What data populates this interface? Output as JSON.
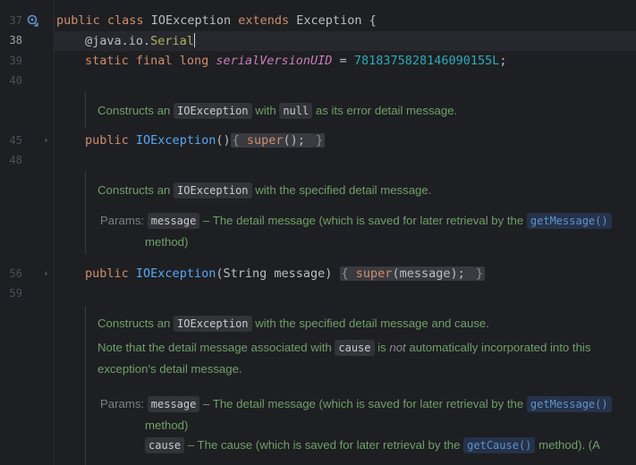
{
  "gutter": {
    "line_numbers": [
      "37",
      "38",
      "39",
      "40",
      "45",
      "48",
      "56",
      "59"
    ]
  },
  "code": {
    "class_decl": {
      "kw1": "public",
      "kw2": "class",
      "name": "IOException",
      "kw3": "extends",
      "parent": "Exception",
      "brace": "{"
    },
    "annotation": {
      "at": "@java.io.",
      "name": "Serial"
    },
    "field": {
      "kw1": "static",
      "kw2": "final",
      "kw3": "long",
      "name": "serialVersionUID",
      "eq": "=",
      "value": "7818375828146090155L",
      "semi": ";"
    },
    "ctor1": {
      "kw": "public",
      "name": "IOException",
      "parens": "()",
      "open": "{",
      "body_kw": "super",
      "body_rest": "();",
      "close": "}"
    },
    "ctor2": {
      "kw": "public",
      "name": "IOException",
      "params": "(String message)",
      "open": "{",
      "body_kw": "super",
      "body_rest": "(message);",
      "close": "}"
    }
  },
  "docs": {
    "doc1": {
      "pre": "Constructs an",
      "chip": "IOException",
      "mid": "with",
      "chip2": "null",
      "post": "as its error detail message."
    },
    "doc2": {
      "pre": "Constructs an",
      "chip": "IOException",
      "post": "with the specified detail message.",
      "params_label": "Params:",
      "param_chip": "message",
      "param_text": "– The detail message (which is saved for later retrieval by the",
      "link": "getMessage()",
      "cont": "method)"
    },
    "doc3": {
      "pre": "Constructs an",
      "chip": "IOException",
      "post": "with the specified detail message and cause.",
      "note_pre": "Note that the detail message associated with",
      "note_chip": "cause",
      "note_is": "is",
      "note_not": "not",
      "note_post": "automatically incorporated into this",
      "note_line2": "exception's detail message.",
      "params_label": "Params:",
      "p1_chip": "message",
      "p1_text": "– The detail message (which is saved for later retrieval by the",
      "p1_link": "getMessage()",
      "p1_cont": "method)",
      "p2_chip": "cause",
      "p2_text": "– The cause (which is saved for later retrieval by the",
      "p2_link": "getCause()",
      "p2_post": "method). (A"
    }
  }
}
